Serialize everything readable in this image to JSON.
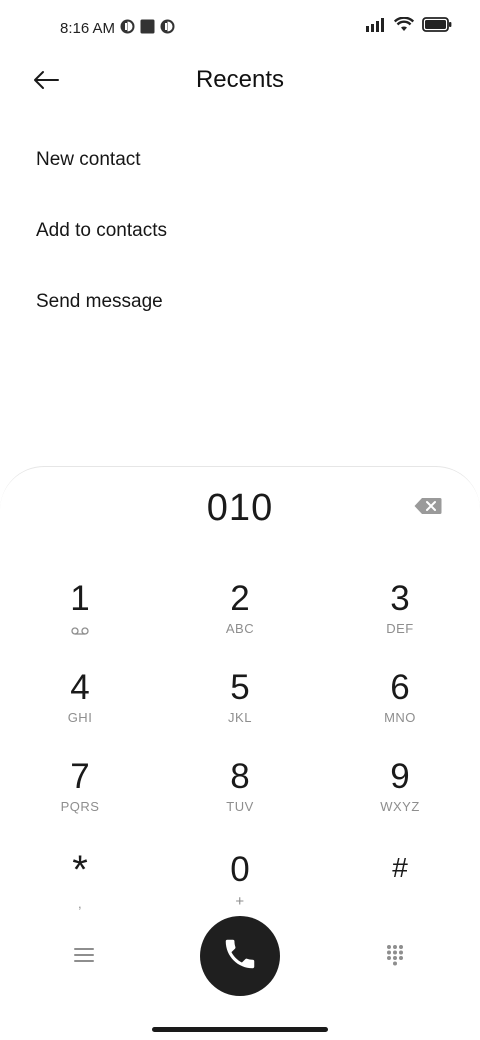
{
  "status_bar": {
    "time": "8:16 AM",
    "icons_left": [
      "app-notification-icon",
      "square-notification-icon",
      "app-notification-icon"
    ],
    "icons_right": [
      "signal-icon",
      "wifi-icon",
      "battery-icon"
    ]
  },
  "header": {
    "title": "Recents",
    "back_icon": "arrow-left-icon"
  },
  "menu": {
    "items": [
      {
        "label": "New contact"
      },
      {
        "label": "Add to contacts"
      },
      {
        "label": "Send message"
      }
    ]
  },
  "dialer": {
    "number": "010",
    "backspace_icon": "backspace-icon",
    "keys": [
      {
        "digit": "1",
        "letters": ""
      },
      {
        "digit": "2",
        "letters": "ABC"
      },
      {
        "digit": "3",
        "letters": "DEF"
      },
      {
        "digit": "4",
        "letters": "GHI"
      },
      {
        "digit": "5",
        "letters": "JKL"
      },
      {
        "digit": "6",
        "letters": "MNO"
      },
      {
        "digit": "7",
        "letters": "PQRS"
      },
      {
        "digit": "8",
        "letters": "TUV"
      },
      {
        "digit": "9",
        "letters": "WXYZ"
      },
      {
        "digit": "*",
        "letters": ","
      },
      {
        "digit": "0",
        "letters": "+"
      },
      {
        "digit": "#",
        "letters": ""
      }
    ],
    "actions": {
      "menu_icon": "hamburger-menu-icon",
      "call_icon": "phone-icon",
      "dialpad_icon": "dialpad-icon",
      "call_button_color": "#1f1f1f"
    }
  }
}
